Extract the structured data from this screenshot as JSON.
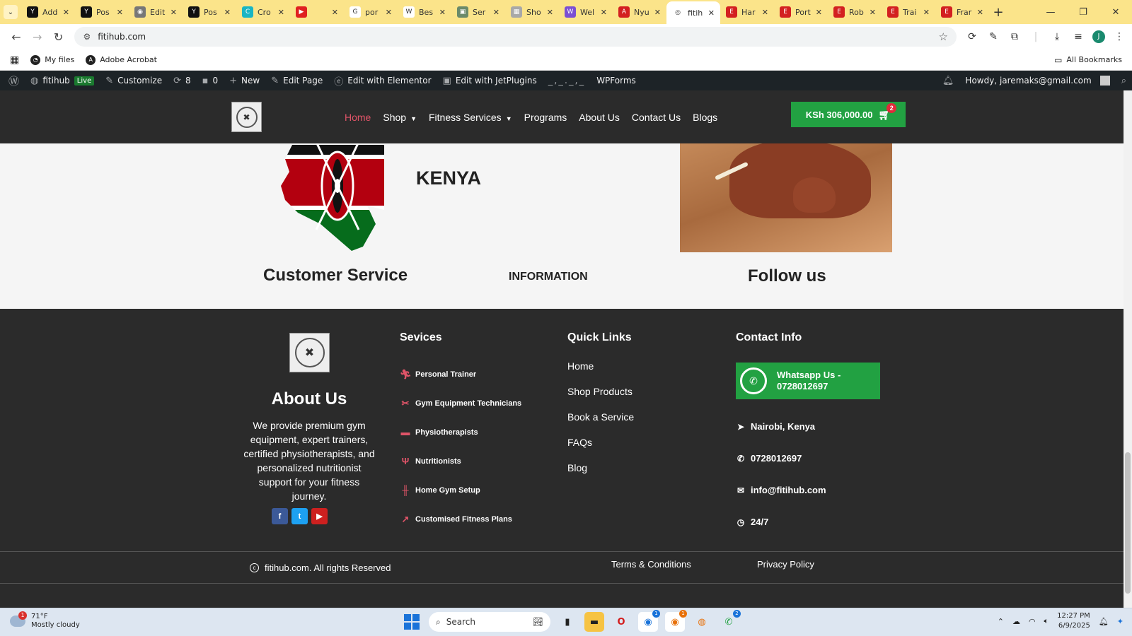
{
  "browser": {
    "tabs": [
      {
        "title": "Add",
        "color": "#111111",
        "glyph": "Y"
      },
      {
        "title": "Pos",
        "color": "#111111",
        "glyph": "Y"
      },
      {
        "title": "Edit",
        "color": "#777777",
        "glyph": "◉"
      },
      {
        "title": "Pos",
        "color": "#111111",
        "glyph": "Y"
      },
      {
        "title": "Cro",
        "color": "#19b5c4",
        "glyph": "C"
      },
      {
        "title": "",
        "color": "#e02020",
        "glyph": "▶"
      },
      {
        "title": "por",
        "color": "#ffffff",
        "glyph": "G"
      },
      {
        "title": "Bes",
        "color": "#ffffff",
        "glyph": "W"
      },
      {
        "title": "Ser",
        "color": "#6a8a6a",
        "glyph": "▣"
      },
      {
        "title": "Sho",
        "color": "#a8a8a8",
        "glyph": "▦"
      },
      {
        "title": "Wel",
        "color": "#7b4fd3",
        "glyph": "W"
      },
      {
        "title": "Nyu",
        "color": "#d32020",
        "glyph": "A"
      },
      {
        "title": "fitih",
        "color": "#ffffff",
        "glyph": "◎"
      },
      {
        "title": "Har",
        "color": "#d32020",
        "glyph": "E"
      },
      {
        "title": "Port",
        "color": "#d32020",
        "glyph": "E"
      },
      {
        "title": "Rob",
        "color": "#d32020",
        "glyph": "E"
      },
      {
        "title": "Trai",
        "color": "#d32020",
        "glyph": "E"
      },
      {
        "title": "Frar",
        "color": "#d32020",
        "glyph": "E"
      }
    ],
    "active_tab_index": 12,
    "url": "fitihub.com",
    "bookmarks": [
      {
        "label": "My files"
      },
      {
        "label": "Adobe Acrobat"
      }
    ],
    "all_bookmarks_label": "All Bookmarks",
    "profile_initial": "J"
  },
  "wp_admin": {
    "site_name": "fitihub",
    "live_badge": "Live",
    "customize": "Customize",
    "updates_count": "8",
    "comments_count": "0",
    "new_label": "New",
    "edit_page": "Edit Page",
    "edit_elementor": "Edit with Elementor",
    "edit_jetplugins": "Edit with JetPlugins",
    "wpforms": "WPForms",
    "howdy": "Howdy, jaremaks@gmail.com"
  },
  "site_header": {
    "nav": [
      {
        "label": "Home",
        "active": true,
        "dropdown": false
      },
      {
        "label": "Shop",
        "active": false,
        "dropdown": true
      },
      {
        "label": "Fitness Services",
        "active": false,
        "dropdown": true
      },
      {
        "label": "Programs",
        "active": false,
        "dropdown": false
      },
      {
        "label": "About Us",
        "active": false,
        "dropdown": false
      },
      {
        "label": "Contact Us",
        "active": false,
        "dropdown": false
      },
      {
        "label": "Blogs",
        "active": false,
        "dropdown": false
      }
    ],
    "cart_total": "KSh 306,000.00",
    "cart_count": "2"
  },
  "upper": {
    "kenya_title": "KENYA",
    "customer_service": "Customer Service",
    "information": "INFORMATION",
    "follow_us": "Follow us"
  },
  "footer": {
    "about_title": "About Us",
    "about_text": "We provide premium gym equipment, expert trainers, certified physiotherapists, and personalized nutritionist support for your fitness journey.",
    "services_title": "Sevices",
    "services": [
      {
        "label": "Personal Trainer",
        "icon": "runner-icon"
      },
      {
        "label": "Gym Equipment Technicians",
        "icon": "tools-icon"
      },
      {
        "label": "Physiotherapists",
        "icon": "bed-icon"
      },
      {
        "label": "Nutritionists",
        "icon": "utensils-icon"
      },
      {
        "label": "Home Gym Setup",
        "icon": "dumbbell-icon"
      },
      {
        "label": "Customised Fitness Plans",
        "icon": "chart-line-icon"
      }
    ],
    "quick_links_title": "Quick Links",
    "quick_links": [
      "Home",
      "Shop Products",
      "Book a Service",
      "FAQs",
      "Blog"
    ],
    "contact_title": "Contact Info",
    "whatsapp_label": "Whatsapp Us - 0728012697",
    "contacts": [
      {
        "label": "Nairobi, Kenya",
        "icon": "location-arrow-icon"
      },
      {
        "label": "0728012697",
        "icon": "phone-icon"
      },
      {
        "label": "info@fitihub.com",
        "icon": "envelope-icon"
      },
      {
        "label": "24/7",
        "icon": "clock-icon"
      }
    ],
    "copyright": "fitihub.com. All rights Reserved",
    "terms": "Terms & Conditions",
    "privacy": "Privacy Policy"
  },
  "taskbar": {
    "weather_temp": "71°F",
    "weather_desc": "Mostly cloudy",
    "weather_badge": "1",
    "search_placeholder": "Search",
    "time": "12:27 PM",
    "date": "6/9/2025",
    "chrome_badge_1": "1",
    "chrome_badge_2": "1",
    "whatsapp_badge": "2"
  },
  "colors": {
    "accent_active_nav": "#e05468",
    "cart_green": "#22a142",
    "footer_bg": "#2b2b2b",
    "wp_bar_bg": "#1d2327",
    "tabbar_bg": "#fbe48a"
  }
}
